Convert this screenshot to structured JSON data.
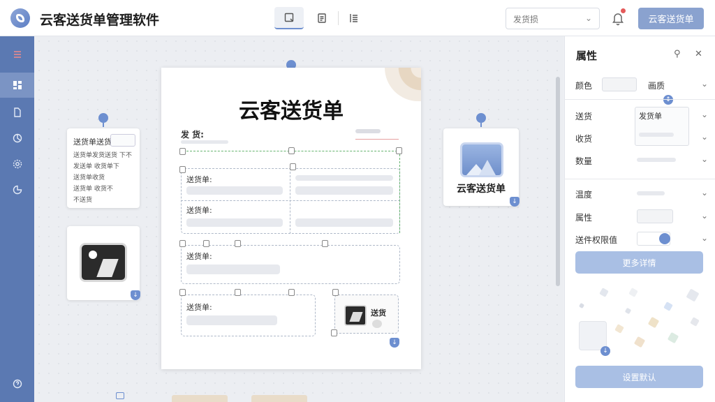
{
  "app": {
    "title": "云客送货单管理软件"
  },
  "toolbar": {
    "select_value": "发货损",
    "primary_button": "云客送货单"
  },
  "document": {
    "title": "云客送货单",
    "header_label": "发 货:",
    "header_right": "",
    "fields": [
      "送货单:",
      "送货单:",
      "送货单:",
      "送货单:"
    ],
    "image_caption": "送货"
  },
  "left_note": {
    "label": "送货单送货",
    "lines": [
      "送货单发货送货 下不",
      "发送单 收货单下",
      "送货单收货",
      "送货单 收货不",
      "不送货"
    ]
  },
  "right_card": {
    "label": "云客送货单"
  },
  "panel": {
    "title": "属性",
    "rows": [
      {
        "label": "颜色",
        "value": "画质"
      },
      {
        "label": "送货",
        "value": "发货单"
      },
      {
        "label": "收货",
        "value": ""
      },
      {
        "label": "数量",
        "value": ""
      },
      {
        "label": "温度",
        "value": ""
      },
      {
        "label": "属性",
        "value": ""
      },
      {
        "label": "送件权限值",
        "value": ""
      }
    ],
    "button_top": "更多详情",
    "button_bottom": "设置默认"
  },
  "colors": {
    "accent": "#5b79b2",
    "button": "#8aa2cf",
    "panel_button": "#a9bfe4",
    "pin": "#6d8fd0"
  },
  "icons": [
    "logo-icon",
    "document-icon",
    "list-icon",
    "bell-icon",
    "menu-icon",
    "dashboard-icon",
    "file-icon",
    "chart-icon",
    "settings-icon",
    "clock-icon",
    "help-icon",
    "filter-icon",
    "close-icon",
    "image-icon"
  ]
}
